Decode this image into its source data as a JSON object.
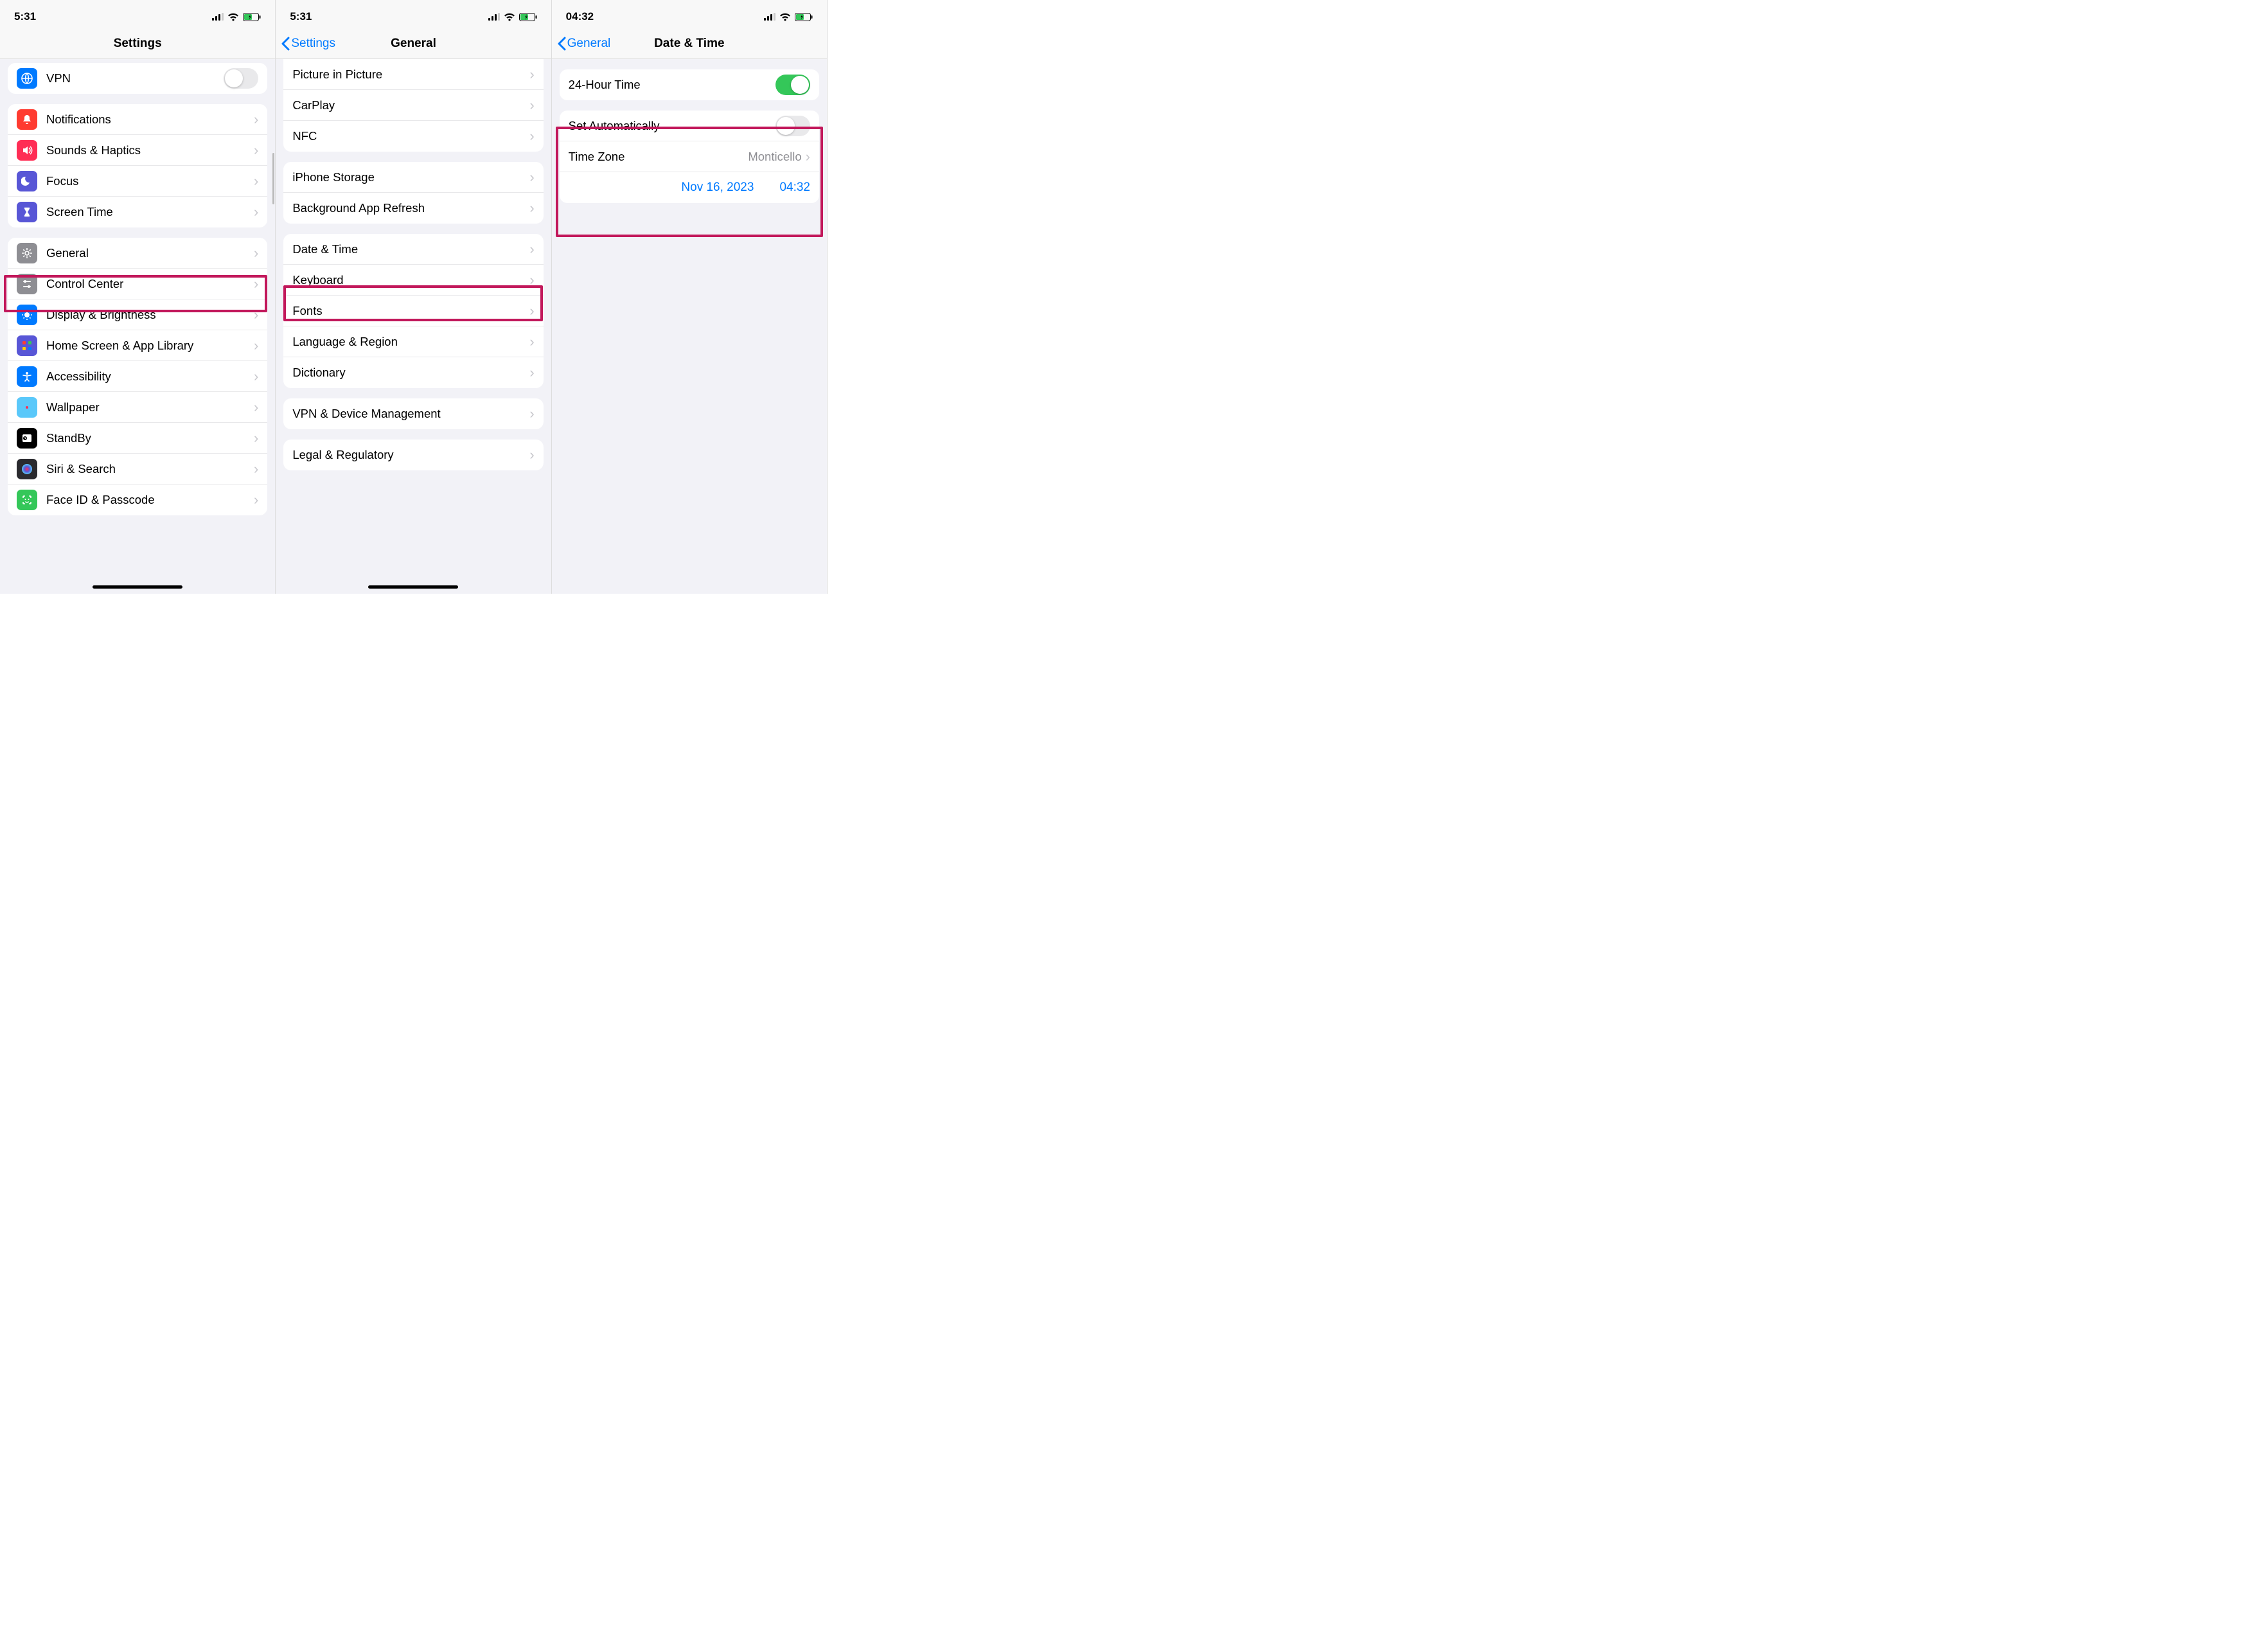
{
  "phone1": {
    "statusTime": "5:31",
    "title": "Settings",
    "vpn": {
      "label": "VPN"
    },
    "group2": [
      {
        "label": "Notifications",
        "color": "#ff3b30",
        "icon": "bell"
      },
      {
        "label": "Sounds & Haptics",
        "color": "#ff2d55",
        "icon": "speaker"
      },
      {
        "label": "Focus",
        "color": "#5856d6",
        "icon": "moon"
      },
      {
        "label": "Screen Time",
        "color": "#5856d6",
        "icon": "hourglass"
      }
    ],
    "group3": [
      {
        "label": "General",
        "color": "#8e8e93",
        "icon": "gear"
      },
      {
        "label": "Control Center",
        "color": "#8e8e93",
        "icon": "sliders"
      },
      {
        "label": "Display & Brightness",
        "color": "#007aff",
        "icon": "sun"
      },
      {
        "label": "Home Screen & App Library",
        "color": "#5856d6",
        "icon": "grid"
      },
      {
        "label": "Accessibility",
        "color": "#007aff",
        "icon": "accessibility"
      },
      {
        "label": "Wallpaper",
        "color": "#5ac8fa",
        "icon": "flower"
      },
      {
        "label": "StandBy",
        "color": "#000000",
        "icon": "clock"
      },
      {
        "label": "Siri & Search",
        "color": "#2a2a2e",
        "icon": "siri"
      },
      {
        "label": "Face ID & Passcode",
        "color": "#34c759",
        "icon": "faceid"
      }
    ]
  },
  "phone2": {
    "statusTime": "5:31",
    "back": "Settings",
    "title": "General",
    "group1": [
      {
        "label": "Picture in Picture"
      },
      {
        "label": "CarPlay"
      },
      {
        "label": "NFC"
      }
    ],
    "group2": [
      {
        "label": "iPhone Storage"
      },
      {
        "label": "Background App Refresh"
      }
    ],
    "group3": [
      {
        "label": "Date & Time"
      },
      {
        "label": "Keyboard"
      },
      {
        "label": "Fonts"
      },
      {
        "label": "Language & Region"
      },
      {
        "label": "Dictionary"
      }
    ],
    "group4": [
      {
        "label": "VPN & Device Management"
      }
    ],
    "group5": [
      {
        "label": "Legal & Regulatory"
      }
    ]
  },
  "phone3": {
    "statusTime": "04:32",
    "back": "General",
    "title": "Date & Time",
    "twentyFourLabel": "24-Hour Time",
    "setAutoLabel": "Set Automatically",
    "timeZoneLabel": "Time Zone",
    "timeZoneValue": "Monticello",
    "dateValue": "Nov 16, 2023",
    "timeValue": "04:32"
  }
}
